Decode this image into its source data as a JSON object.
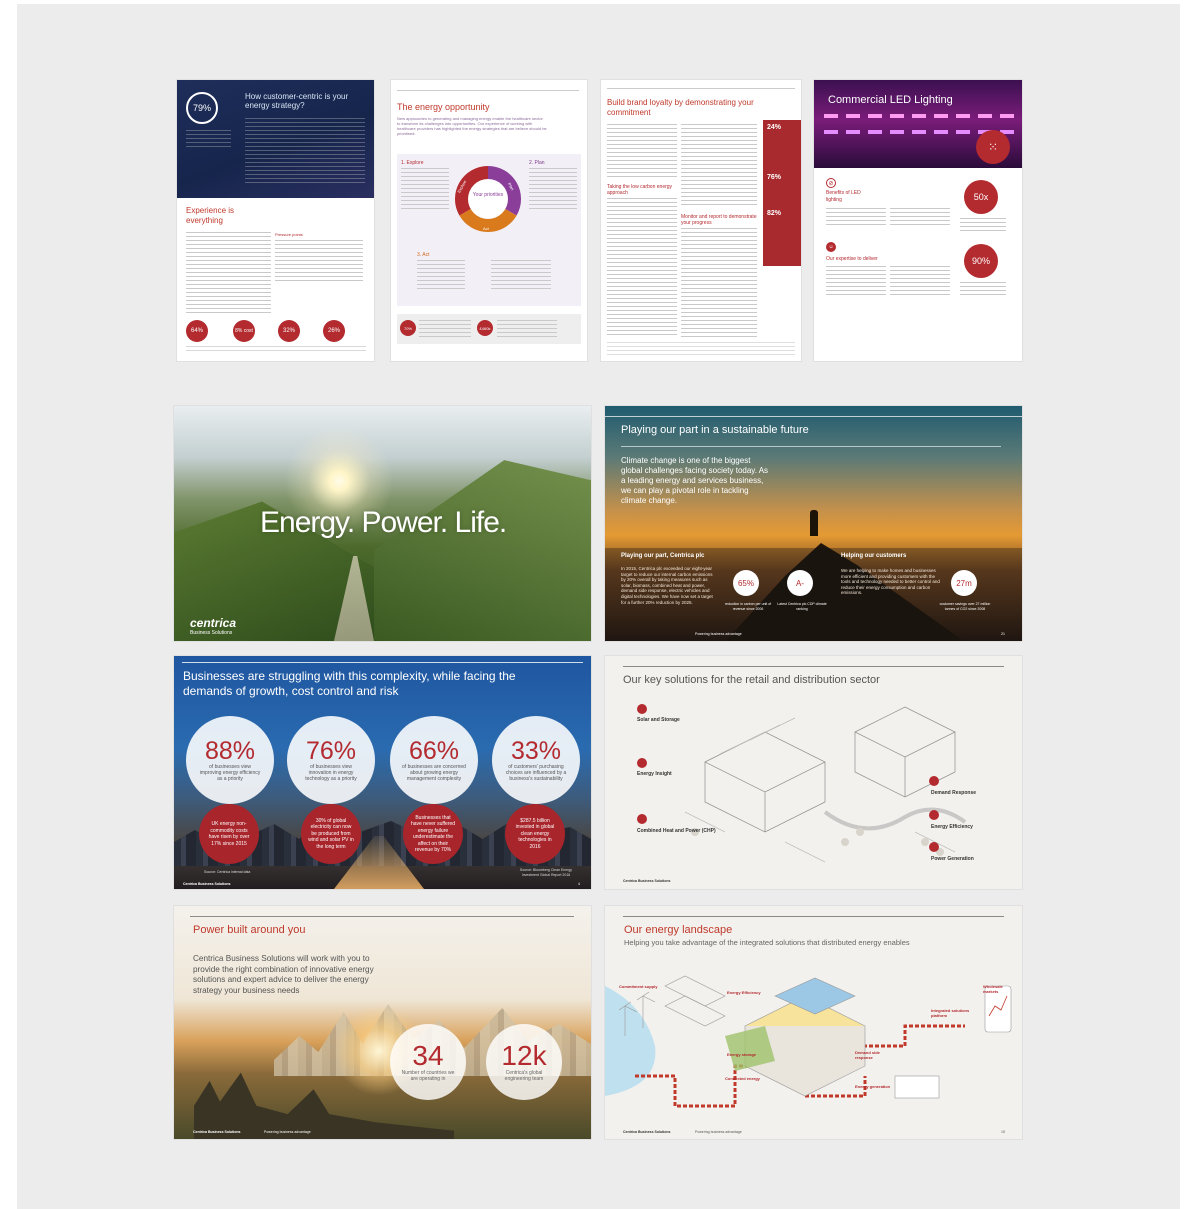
{
  "pages": {
    "p1": {
      "ring_value": "79%",
      "title": "How customer-centric is your energy strategy?",
      "heading": "Experience is everything",
      "subheading": "Pressure points",
      "stats": [
        "64%",
        "8% cost",
        "32%",
        "26%"
      ]
    },
    "p2": {
      "title": "The energy opportunity",
      "intro": "New approaches to generating and managing energy enable the healthcare sector to transform its challenges into opportunities. Our experience of working with healthcare providers has highlighted the energy strategies that are believe should be prioritised:",
      "step1": "1. Explore",
      "step2": "2. Plan",
      "step3": "3. Act",
      "wheel_center": "Your priorities",
      "wheel_explore": "Explore",
      "wheel_plan": "Plan",
      "wheel_act": "Act",
      "stat1": "70%",
      "stat2": "£460k"
    },
    "p3": {
      "title": "Build brand loyalty by demonstrating your commitment",
      "sub1": "Taking the low carbon energy approach",
      "sub2": "Monitor and report to demonstrate your progress",
      "stats": [
        "24%",
        "76%",
        "82%"
      ]
    },
    "p4": {
      "title": "Commercial LED Lighting",
      "benefits": "Benefits of LED lighting",
      "expertise": "Our expertise to deliver",
      "stat1": "50x",
      "stat2": "90%"
    },
    "p5": {
      "headline": "Energy. Power. Life.",
      "brand": "centrica",
      "brand_sub": "Business Solutions"
    },
    "p6": {
      "title": "Playing our part in a sustainable future",
      "lead": "Climate change is one of the biggest global challenges facing society today. As a leading energy and services business, we can play a pivotal role in tackling climate change.",
      "col1_heading": "Playing our part, Centrica plc",
      "col1_text": "In 2015, Centrica plc exceeded our eight-year target to reduce our internal carbon emissions by 20% overall by taking measures such as solar, biomass, combined heat and power, demand side response, electric vehicles and digital technologies. We have now set a target for a further 20% reduction by 2025.",
      "stat1": "65%",
      "stat1_label": "reduction in carbon per unit of revenue since 2006",
      "stat2": "A-",
      "stat2_label": "Latest Centrica plc CDP climate ranking",
      "col2_heading": "Helping our customers",
      "col2_text": "We are helping to make homes and businesses more efficient and providing customers with the tools and technology needed to better control and reduce their energy consumption and carbon emissions.",
      "stat3": "27m",
      "stat3_label": "customer savings over 27 million tonnes of CO2 since 2008",
      "footer": "Powering business advantage",
      "page_no": "21"
    },
    "p7": {
      "title": "Businesses are struggling with this complexity, while facing the demands of growth, cost control and risk",
      "stats": [
        {
          "value": "88%",
          "label": "of businesses view improving energy efficiency as a priority",
          "detail": "UK energy non-commodity costs have risen by over 17% since 2015"
        },
        {
          "value": "76%",
          "label": "of businesses view innovation in energy technology as a priority",
          "detail": "30% of global electricity can now be produced from wind and solar PV in the long term"
        },
        {
          "value": "66%",
          "label": "of businesses are concerned about growing energy management complexity",
          "detail": "Businesses that have never suffered energy failure underestimate the affect on their revenue by 70%"
        },
        {
          "value": "33%",
          "label": "of customers' purchasing choices are influenced by a business's sustainability",
          "detail": "$287.5 billion invested in global clean energy technologies in 2016"
        }
      ],
      "src1": "Source: Centrica internal data",
      "src4": "Source: Bloomberg Clean Energy Investment Global Report 2016",
      "brand": "Centrica Business Solutions",
      "page_no": "4"
    },
    "p8": {
      "title": "Our key solutions for the retail and distribution sector",
      "labels": [
        "Solar and Storage",
        "Energy Insight",
        "Combined Heat and Power (CHP)",
        "Demand Response",
        "Energy Efficiency",
        "Power Generation"
      ],
      "brand": "Centrica Business Solutions"
    },
    "p9": {
      "title": "Power built around you",
      "body": "Centrica Business Solutions will work with you to provide the right combination of innovative energy solutions and expert advice to deliver the energy strategy your business needs",
      "stat1": "34",
      "stat1_label": "Number of countries we are operating in",
      "stat2": "12k",
      "stat2_label": "Centrica's global engineering team",
      "brand": "Centrica Business Solutions",
      "footer": "Powering business advantage"
    },
    "p10": {
      "title": "Our energy landscape",
      "subtitle": "Helping you take advantage of the integrated solutions that distributed energy enables",
      "labels": [
        "Commitment supply",
        "Energy Efficiency",
        "Integrated solutions platform",
        "Wholesale markets",
        "Energy storage",
        "Demand side response",
        "Energy generation",
        "Connected energy"
      ],
      "brand": "Centrica Business Solutions",
      "footer": "Powering business advantage",
      "page_no": "15"
    }
  }
}
